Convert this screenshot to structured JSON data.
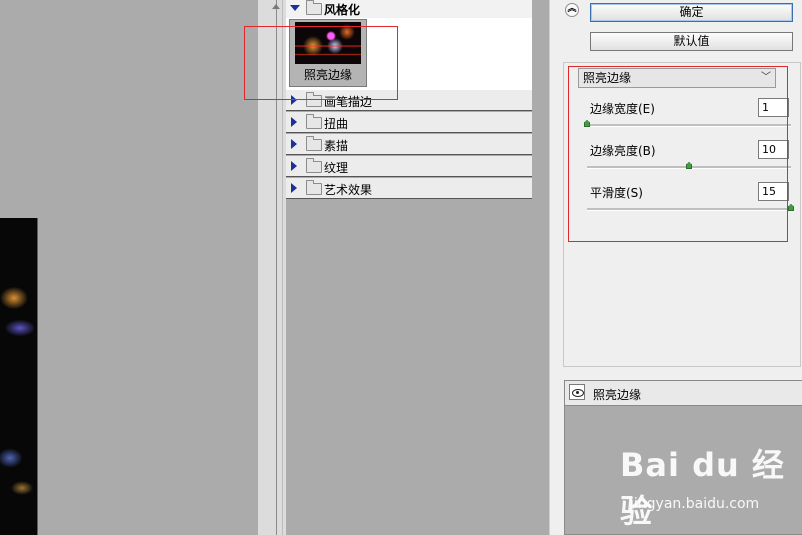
{
  "filter_gallery": {
    "open_category": {
      "label": "风格化"
    },
    "selected_filter": {
      "label": "照亮边缘"
    },
    "categories": [
      {
        "label": "画笔描边"
      },
      {
        "label": "扭曲"
      },
      {
        "label": "素描"
      },
      {
        "label": "纹理"
      },
      {
        "label": "艺术效果"
      }
    ]
  },
  "buttons": {
    "ok": "确定",
    "default": "默认值"
  },
  "settings": {
    "filter_select": "照亮边缘",
    "params": [
      {
        "label": "边缘宽度(E)",
        "value": "1",
        "min": 1,
        "max": 14
      },
      {
        "label": "边缘亮度(B)",
        "value": "10",
        "min": 0,
        "max": 20
      },
      {
        "label": "平滑度(S)",
        "value": "15",
        "min": 1,
        "max": 15
      }
    ]
  },
  "layer": {
    "name": "照亮边缘"
  },
  "watermark": {
    "logo": "Bai du 经验",
    "url": "jingyan.baidu.com"
  },
  "colors": {
    "highlight_box": "#e02a2a",
    "slider_thumb": "#3f9f3f",
    "expand_triangle": "#1d2f9a"
  }
}
